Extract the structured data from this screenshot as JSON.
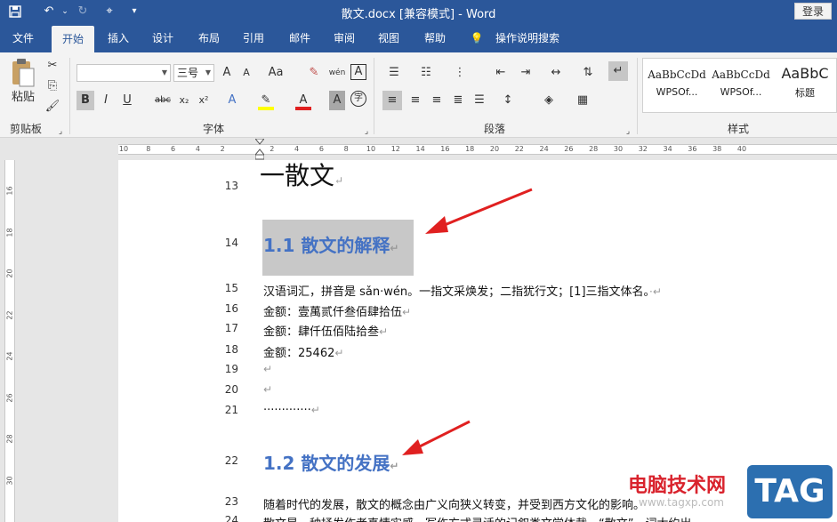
{
  "window": {
    "title": "散文.docx [兼容模式]  -  Word",
    "login_label": "登录"
  },
  "menu_tabs": [
    "文件",
    "开始",
    "插入",
    "设计",
    "布局",
    "引用",
    "邮件",
    "审阅",
    "视图",
    "帮助",
    "操作说明搜索"
  ],
  "ribbon": {
    "clipboard": {
      "paste_label": "粘贴",
      "group_label": "剪贴板"
    },
    "font": {
      "font_name": "",
      "font_size": "三号",
      "group_label": "字体",
      "bold": "B",
      "italic": "I",
      "underline": "U",
      "strike": "abc",
      "sub": "x₂",
      "sup": "x²",
      "grow": "A",
      "shrink": "A",
      "case": "Aa",
      "pinyin": "wén",
      "border_char": "A",
      "font_color": "A",
      "shade": "A",
      "enclose": "字",
      "effect": "A"
    },
    "paragraph": {
      "group_label": "段落"
    },
    "styles": {
      "group_label": "样式",
      "items": [
        {
          "preview": "AaBbCcDd",
          "name": "WPSOf..."
        },
        {
          "preview": "AaBbCcDd",
          "name": "WPSOf..."
        },
        {
          "preview": "AaBbC",
          "name": "标题"
        }
      ]
    }
  },
  "ruler": {
    "h_ticks": [
      "10",
      "8",
      "6",
      "4",
      "2",
      "",
      "2",
      "4",
      "6",
      "8",
      "10",
      "12",
      "14",
      "16",
      "18",
      "20",
      "22",
      "24",
      "26",
      "28",
      "30",
      "32",
      "34",
      "36",
      "38",
      "40"
    ],
    "v_ticks": [
      "16",
      "18",
      "20",
      "22",
      "24",
      "26",
      "28",
      "30"
    ]
  },
  "document": {
    "lines": [
      {
        "num": "13",
        "text": "一散文",
        "mark": "↵"
      },
      {
        "num": "14",
        "text": "1.1 散文的解释",
        "mark": "↵"
      },
      {
        "num": "15",
        "text": "汉语词汇，拼音是 sǎn·wén。一指文采焕发；二指犹行文；[1]三指文体名。",
        "mark": "·↵"
      },
      {
        "num": "16",
        "text": "金额：壹萬贰仟叁佰肆拾伍",
        "mark": "↵"
      },
      {
        "num": "17",
        "text": "金额：肆仟伍佰陆拾叁",
        "mark": "↵"
      },
      {
        "num": "18",
        "text": "金额：25462",
        "mark": "↵"
      },
      {
        "num": "19",
        "text": "",
        "mark": "↵"
      },
      {
        "num": "20",
        "text": "",
        "mark": "↵"
      },
      {
        "num": "21",
        "text": "·············",
        "mark": "↵"
      },
      {
        "num": "22",
        "text": "1.2 散文的发展",
        "mark": "↵"
      },
      {
        "num": "23",
        "text": "随着时代的发展，散文的概念由广义向狭义转变，并受到西方文化的影响。",
        "mark": ""
      },
      {
        "num": "24",
        "text": "散文是一种抒发作者真情实感、写作方式灵活的记叙类文学体裁。“散文”一词大约出",
        "mark": ""
      }
    ]
  },
  "watermark": {
    "site": "电脑技术网",
    "url": "www.tagxp.com",
    "badge": "TAG"
  },
  "colors": {
    "title_bar": "#2b579a",
    "heading": "#4472c4",
    "arrow": "#e02020"
  }
}
